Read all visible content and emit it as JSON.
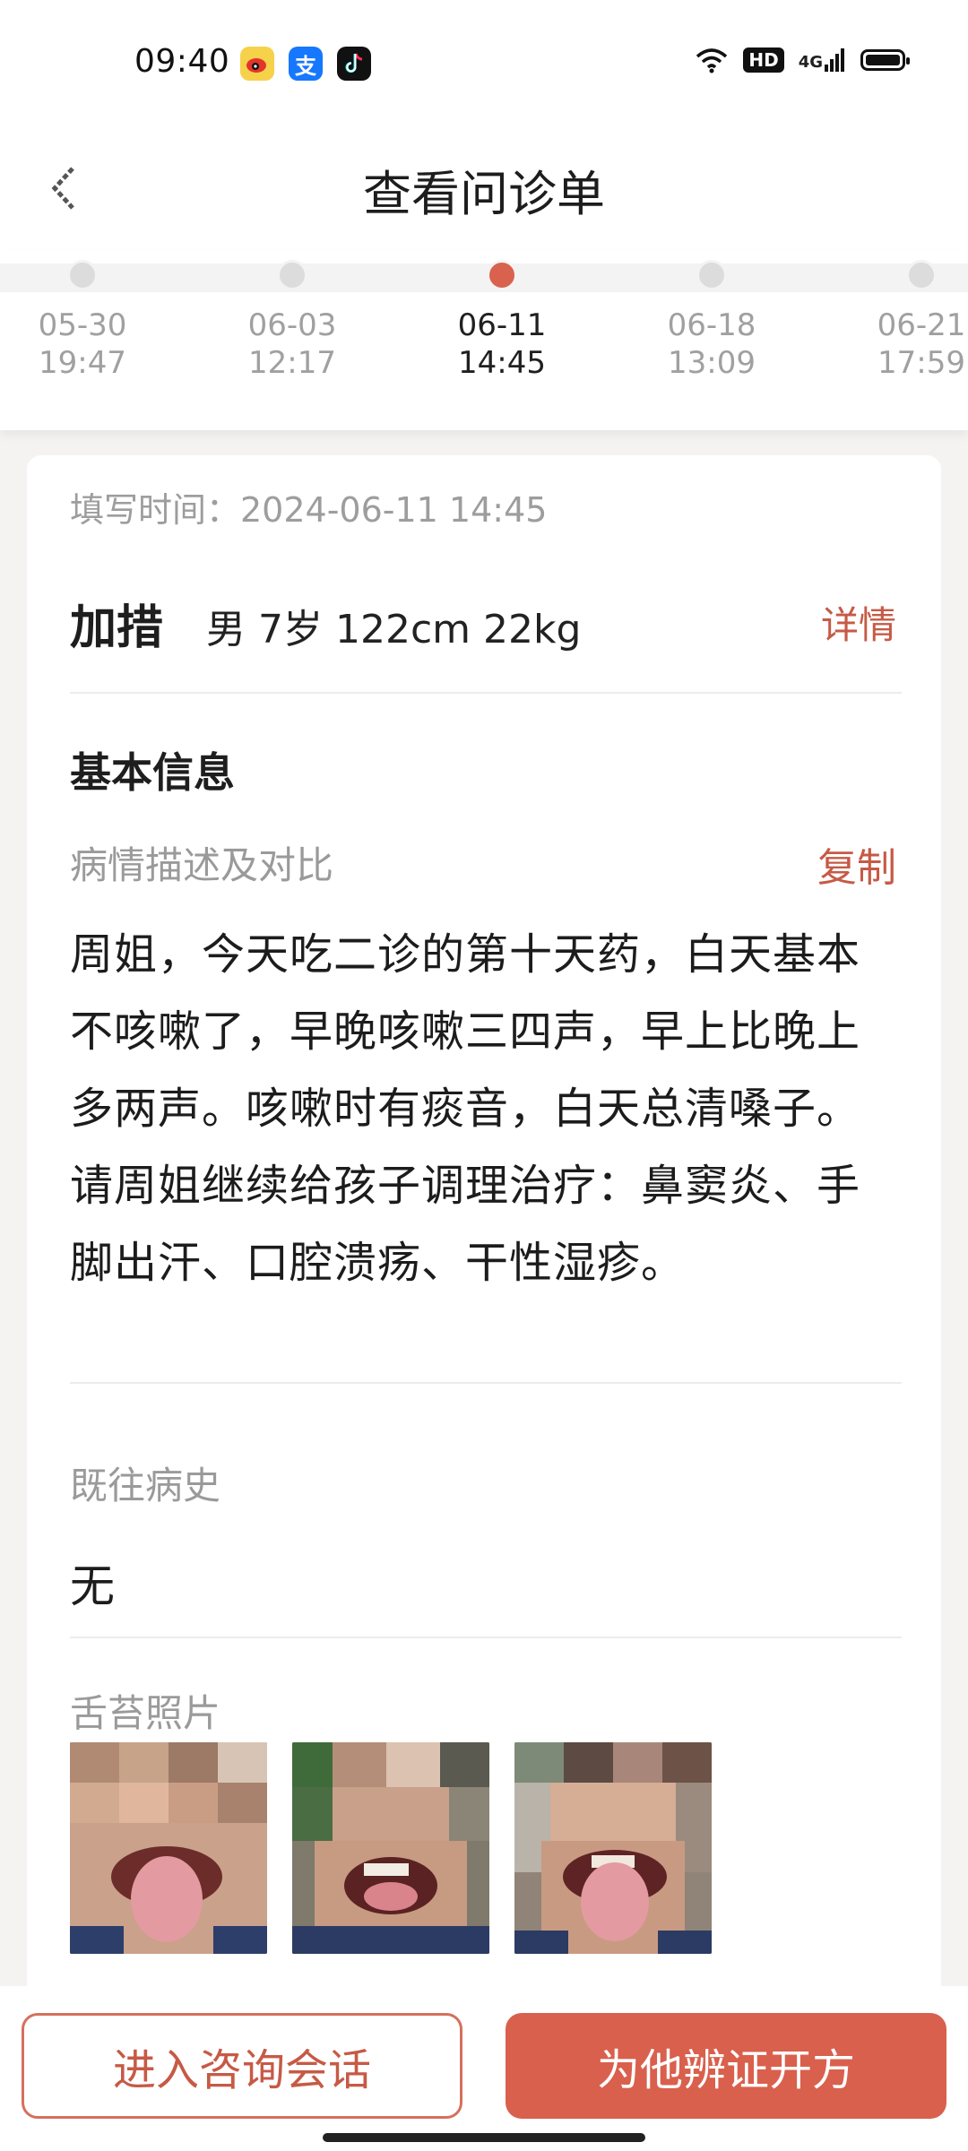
{
  "status_bar": {
    "time": "09:40",
    "apps": [
      "weibo-icon",
      "alipay-icon",
      "tiktok-icon"
    ],
    "network": "4G",
    "hd": "HD"
  },
  "header": {
    "title": "查看问诊单",
    "back_icon": "back-arrow-icon"
  },
  "timeline": [
    {
      "date": "05-30",
      "time": "19:47",
      "active": false
    },
    {
      "date": "06-03",
      "time": "12:17",
      "active": false
    },
    {
      "date": "06-11",
      "time": "14:45",
      "active": true
    },
    {
      "date": "06-18",
      "time": "13:09",
      "active": false
    },
    {
      "date": "06-21",
      "time": "17:59",
      "active": false
    }
  ],
  "card": {
    "fill_time": "填写时间：2024-06-11 14:45",
    "patient": {
      "name": "加措",
      "info": "男 7岁 122cm 22kg",
      "detail_label": "详情"
    },
    "basic_info_title": "基本信息",
    "condition_label": "病情描述及对比",
    "copy_label": "复制",
    "description": "周姐，今天吃二诊的第十天药，白天基本不咳嗽了，早晚咳嗽三四声，早上比晚上多两声。咳嗽时有痰音，白天总清嗓子。请周姐继续给孩子调理治疗：鼻窦炎、手脚出汗、口腔溃疡、干性湿疹。",
    "history_label": "既往病史",
    "history_value": "无",
    "tongue_label": "舌苔照片",
    "photo_count": 3
  },
  "actions": {
    "consult_label": "进入咨询会话",
    "prescribe_label": "为他辨证开方"
  },
  "colors": {
    "accent": "#d9604d",
    "accent_text": "#c65a45",
    "muted_text": "#9a9a9a"
  }
}
